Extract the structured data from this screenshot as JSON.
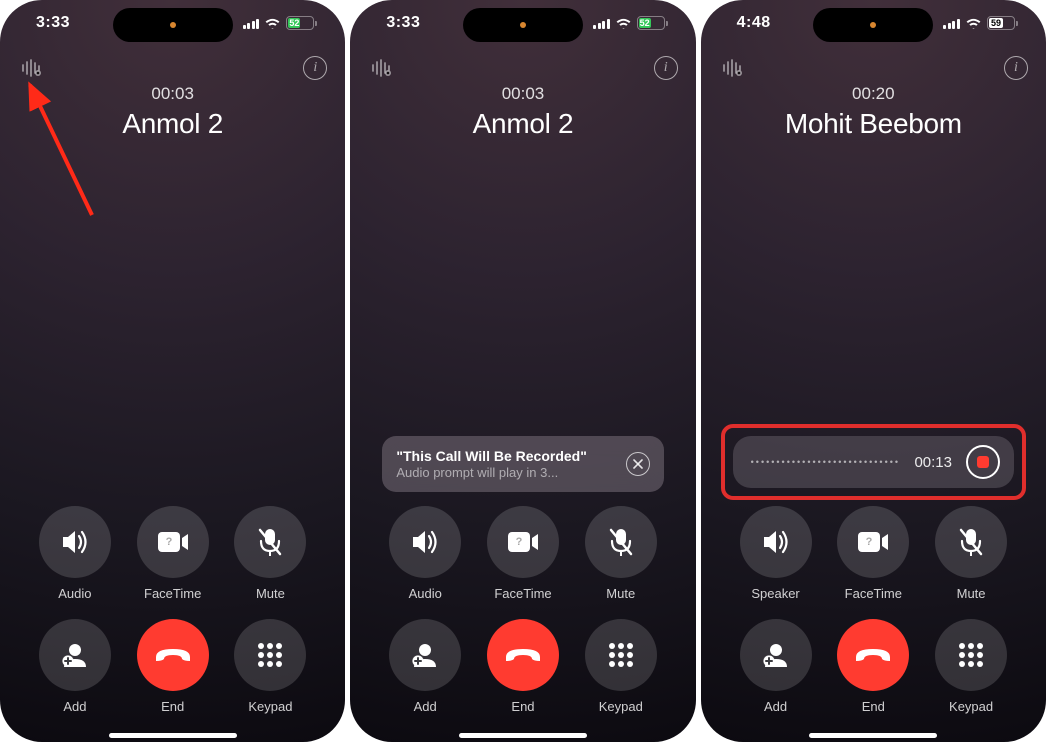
{
  "screens": [
    {
      "status": {
        "time": "3:33",
        "battery": "52",
        "charging": true
      },
      "call": {
        "duration": "00:03",
        "name": "Anmol 2"
      },
      "buttons": [
        {
          "label": "Audio",
          "icon": "speaker"
        },
        {
          "label": "FaceTime",
          "icon": "facetime"
        },
        {
          "label": "Mute",
          "icon": "mute"
        },
        {
          "label": "Add",
          "icon": "add"
        },
        {
          "label": "End",
          "icon": "end"
        },
        {
          "label": "Keypad",
          "icon": "keypad"
        }
      ],
      "arrow": true
    },
    {
      "status": {
        "time": "3:33",
        "battery": "52",
        "charging": true
      },
      "call": {
        "duration": "00:03",
        "name": "Anmol 2"
      },
      "prompt": {
        "line1": "\"This Call Will Be Recorded\"",
        "line2": "Audio prompt will play in 3..."
      },
      "buttons": [
        {
          "label": "Audio",
          "icon": "speaker"
        },
        {
          "label": "FaceTime",
          "icon": "facetime"
        },
        {
          "label": "Mute",
          "icon": "mute"
        },
        {
          "label": "Add",
          "icon": "add"
        },
        {
          "label": "End",
          "icon": "end"
        },
        {
          "label": "Keypad",
          "icon": "keypad"
        }
      ]
    },
    {
      "status": {
        "time": "4:48",
        "battery": "59",
        "charging": false
      },
      "call": {
        "duration": "00:20",
        "name": "Mohit Beebom"
      },
      "recording": {
        "time": "00:13"
      },
      "buttons": [
        {
          "label": "Speaker",
          "icon": "speaker"
        },
        {
          "label": "FaceTime",
          "icon": "facetime"
        },
        {
          "label": "Mute",
          "icon": "mute"
        },
        {
          "label": "Add",
          "icon": "add"
        },
        {
          "label": "End",
          "icon": "end"
        },
        {
          "label": "Keypad",
          "icon": "keypad"
        }
      ]
    }
  ]
}
